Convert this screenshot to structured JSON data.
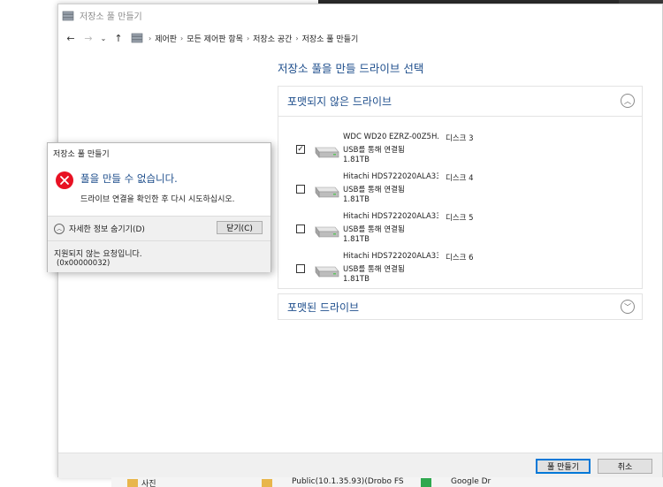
{
  "main_window": {
    "title": "저장소 풀 만들기",
    "breadcrumb": [
      "제어판",
      "모든 제어판 항목",
      "저장소 공간",
      "저장소 풀 만들기"
    ],
    "heading": "저장소 풀을 만들 드라이브 선택",
    "unformatted_section": {
      "title": "포맷되지 않은 드라이브",
      "drives": [
        {
          "name": "WDC WD20 EZRZ-00Z5H...",
          "connection": "USB를 통해 연결됨",
          "size": "1.81TB",
          "disk": "디스크 3",
          "checked": true
        },
        {
          "name": "Hitachi HDS722020ALA33...",
          "connection": "USB를 통해 연결됨",
          "size": "1.81TB",
          "disk": "디스크 4",
          "checked": false
        },
        {
          "name": "Hitachi HDS722020ALA33...",
          "connection": "USB를 통해 연결됨",
          "size": "1.81TB",
          "disk": "디스크 5",
          "checked": false
        },
        {
          "name": "Hitachi HDS722020ALA33...",
          "connection": "USB를 통해 연결됨",
          "size": "1.81TB",
          "disk": "디스크 6",
          "checked": false
        }
      ]
    },
    "formatted_section": {
      "title": "포맷된 드라이브"
    },
    "buttons": {
      "create": "풀 만들기",
      "cancel": "취소"
    }
  },
  "error_dialog": {
    "title": "저장소 풀 만들기",
    "main_instruction": "풀을 만들 수 없습니다.",
    "content": "드라이브 연결을 확인한 후 다시 시도하십시오.",
    "details_toggle": "자세한 정보 숨기기(D)",
    "close_button": "닫기(C)",
    "detail_line1": "지원되지 않는 요청입니다.",
    "detail_line2": "(0x00000032)"
  },
  "background": {
    "peek_items": [
      "사진",
      "Public(10.1.35.93)(Drobo FS",
      "Google Dr"
    ]
  },
  "colors": {
    "accent_blue": "#1e4e8c",
    "error_red": "#e81123",
    "button_blue": "#0078d7"
  }
}
